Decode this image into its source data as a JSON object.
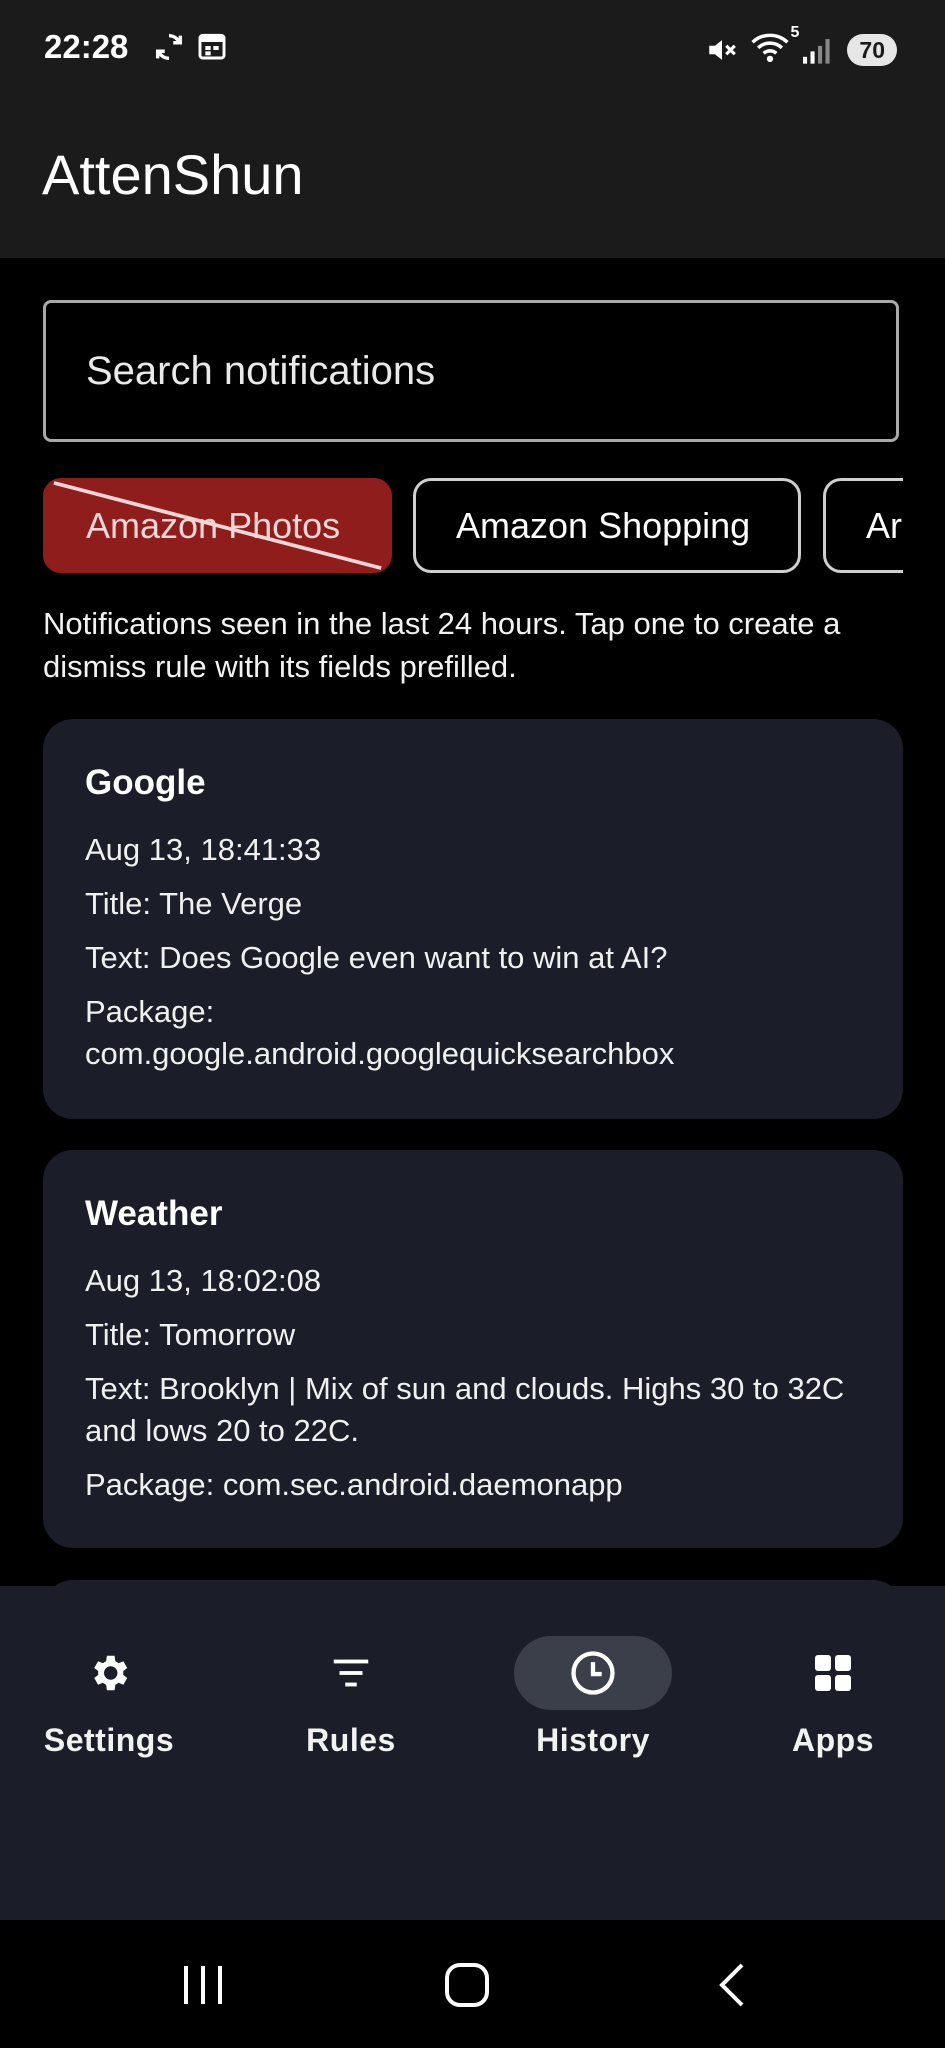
{
  "status": {
    "time": "22:28",
    "battery": "70",
    "wifi_band": "5"
  },
  "app": {
    "title": "AttenShun"
  },
  "search": {
    "placeholder": "Search notifications"
  },
  "chips": [
    {
      "label": "Amazon Photos",
      "state": "excluded"
    },
    {
      "label": "Amazon Shopping",
      "state": "normal"
    },
    {
      "label": "Ar",
      "state": "normal"
    }
  ],
  "hint": "Notifications seen in the last 24 hours. Tap one to create a dismiss rule with its fields prefilled.",
  "notifications": [
    {
      "app": "Google",
      "time": "Aug 13, 18:41:33",
      "title": "Title: The Verge",
      "text": "Text: Does Google even want to win at AI?",
      "package": "Package: com.google.android.googlequicksearchbox"
    },
    {
      "app": "Weather",
      "time": "Aug 13, 18:02:08",
      "title": "Title: Tomorrow",
      "text": "Text: Brooklyn | Mix of sun and clouds. Highs 30 to 32C and lows 20 to 22C.",
      "package": "Package: com.sec.android.daemonapp"
    }
  ],
  "nav": {
    "items": [
      {
        "label": "Settings",
        "icon": "gear-icon"
      },
      {
        "label": "Rules",
        "icon": "filter-icon"
      },
      {
        "label": "History",
        "icon": "clock-icon",
        "active": true
      },
      {
        "label": "Apps",
        "icon": "grid-icon"
      }
    ]
  },
  "colors": {
    "excluded_chip": "#8f1d1c",
    "card_bg": "#1b1d28",
    "bar_bg": "#1b1b1b",
    "active_pill": "#3b3f4a"
  }
}
